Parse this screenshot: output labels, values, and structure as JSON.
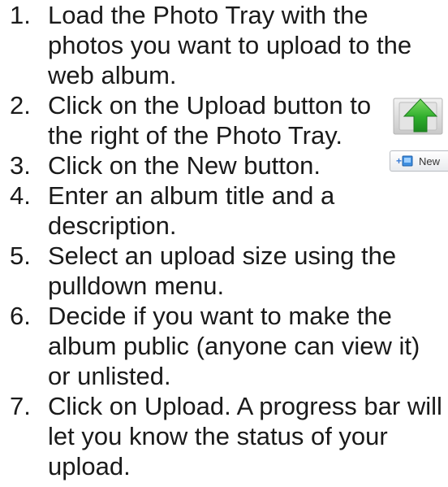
{
  "steps": [
    {
      "num": "1.",
      "text": "Load the Photo Tray with the photos you want to upload to the web album."
    },
    {
      "num": "2.",
      "text": "Click on the Upload button to the right of the Photo Tray."
    },
    {
      "num": "3.",
      "text": "Click on the New button."
    },
    {
      "num": "4.",
      "text": "Enter an album title and a description."
    },
    {
      "num": "5.",
      "text": "Select an upload size using the pulldown menu."
    },
    {
      "num": "6.",
      "text": "Decide if you want to make the album public (anyone can view it) or unlisted."
    },
    {
      "num": "7.",
      "text": "Click on Upload. A progress bar will let you know the status of your upload."
    }
  ],
  "new_button": {
    "label": "New",
    "icon": "add-album-icon"
  },
  "upload_button": {
    "icon": "upload-arrow-icon"
  },
  "colors": {
    "arrow_green": "#2fae2c",
    "text": "#1a1a1a"
  }
}
